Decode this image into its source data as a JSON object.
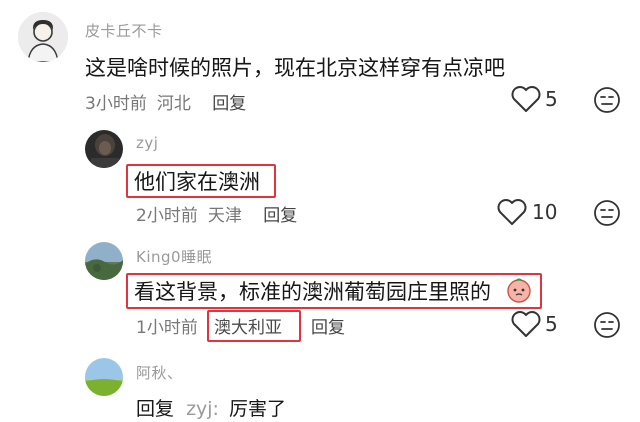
{
  "comments": [
    {
      "username": "皮卡丘不卡",
      "text": "这是啥时候的照片，现在北京这样穿有点凉吧",
      "time": "3小时前",
      "location": "河北",
      "reply_label": "回复",
      "likes": "5"
    },
    {
      "username": "zyj",
      "text": "他们家在澳洲",
      "time": "2小时前",
      "location": "天津",
      "reply_label": "回复",
      "likes": "10"
    },
    {
      "username": "King0睡眠",
      "text": "看这背景，标准的澳洲葡萄园庄里照的",
      "time": "1小时前",
      "location": "澳大利亚",
      "reply_label": "回复",
      "likes": "5"
    },
    {
      "username": "阿秋、",
      "reply_prefix": "回复",
      "reply_to": "zyj:",
      "text": "厉害了"
    }
  ],
  "colors": {
    "highlight": "#e0353e"
  },
  "icons": {
    "like": "heart-outline-icon",
    "more": "emoji-more-icon"
  }
}
